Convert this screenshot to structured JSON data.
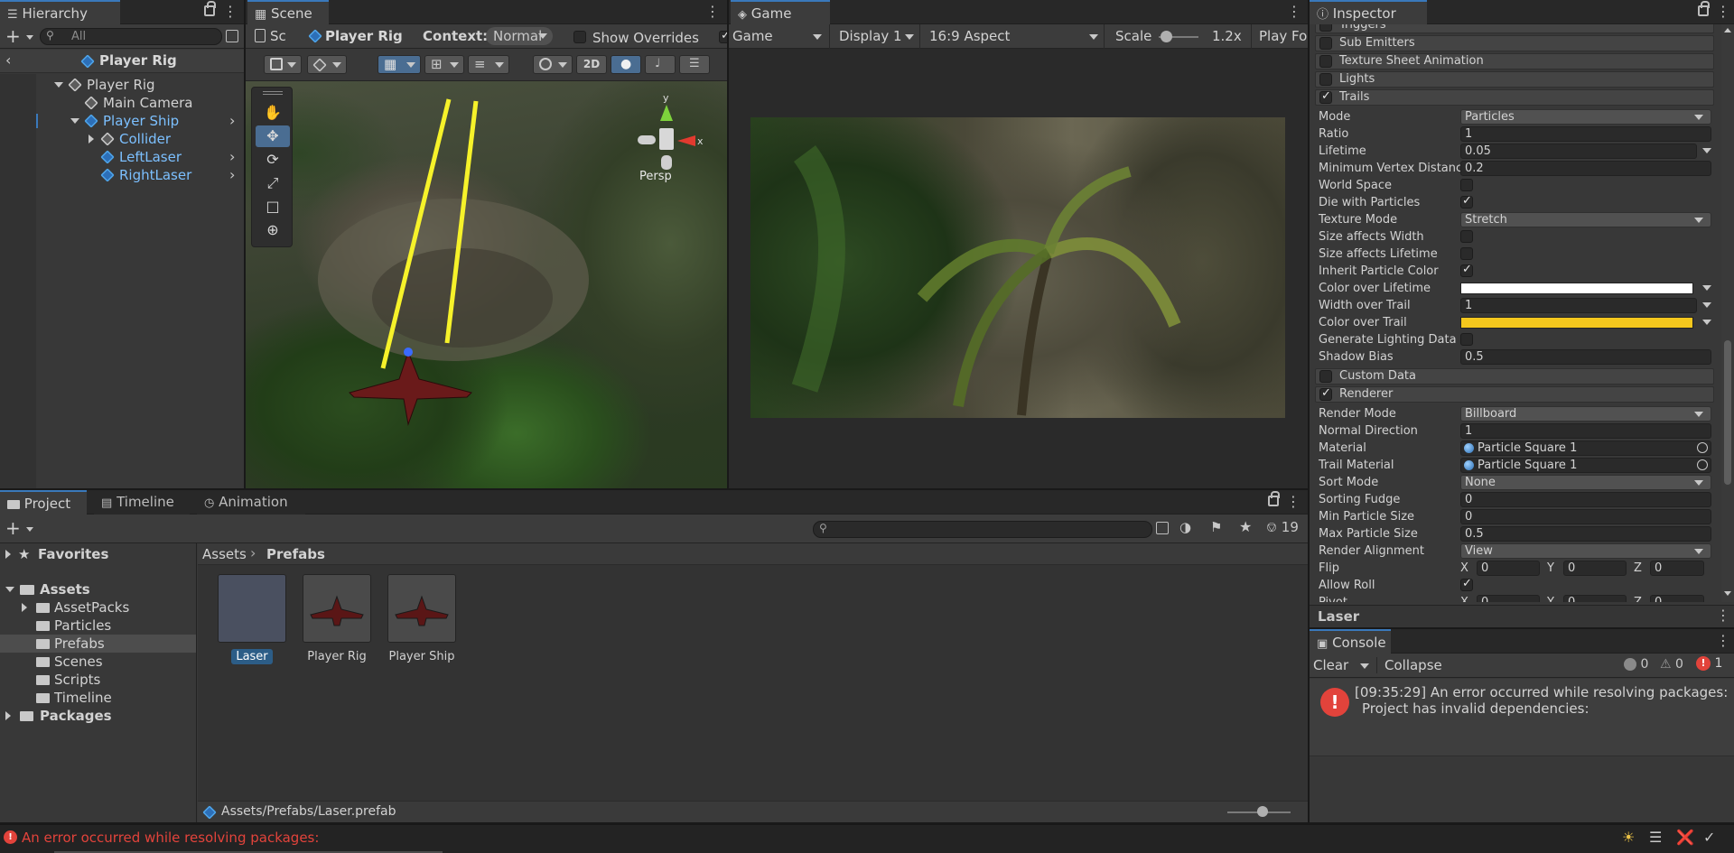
{
  "hierarchy": {
    "tab": "Hierarchy",
    "search_placeholder": "All",
    "scene_title": "Player Rig",
    "items": [
      {
        "label": "Player Rig",
        "depth": 1
      },
      {
        "label": "Main Camera",
        "depth": 2
      },
      {
        "label": "Player Ship",
        "depth": 2
      },
      {
        "label": "Collider",
        "depth": 3
      },
      {
        "label": "LeftLaser",
        "depth": 3
      },
      {
        "label": "RightLaser",
        "depth": 3
      }
    ]
  },
  "scene": {
    "tab": "Scene",
    "breadcrumb_root": "Sc",
    "breadcrumb_item": "Player Rig",
    "context_label": "Context:",
    "context_value": "Normal",
    "show_overrides": "Show Overrides",
    "mode_2d": "2D",
    "gizmo_label": "Persp",
    "gizmo_y": "y",
    "gizmo_x": "x"
  },
  "game": {
    "tab": "Game",
    "display_mode": "Game",
    "display": "Display 1",
    "aspect": "16:9 Aspect",
    "scale_label": "Scale",
    "scale_value": "1.2x",
    "play_focused": "Play Foc"
  },
  "inspector": {
    "tab": "Inspector",
    "sections_top": [
      {
        "label": "Triggers",
        "checked": false
      },
      {
        "label": "Sub Emitters",
        "checked": false
      },
      {
        "label": "Texture Sheet Animation",
        "checked": false
      },
      {
        "label": "Lights",
        "checked": false
      },
      {
        "label": "Trails",
        "checked": true
      }
    ],
    "trails": [
      {
        "label": "Mode",
        "type": "dropdown",
        "value": "Particles"
      },
      {
        "label": "Ratio",
        "type": "text",
        "value": "1"
      },
      {
        "label": "Lifetime",
        "type": "curve",
        "value": "0.05"
      },
      {
        "label": "Minimum Vertex Distance",
        "type": "text",
        "value": "0.2"
      },
      {
        "label": "World Space",
        "type": "check",
        "value": ""
      },
      {
        "label": "Die with Particles",
        "type": "checkon",
        "value": ""
      },
      {
        "label": "Texture Mode",
        "type": "dropdown",
        "value": "Stretch"
      },
      {
        "label": "Size affects Width",
        "type": "check",
        "value": ""
      },
      {
        "label": "Size affects Lifetime",
        "type": "check",
        "value": ""
      },
      {
        "label": "Inherit Particle Color",
        "type": "checkon",
        "value": ""
      },
      {
        "label": "Color over Lifetime",
        "type": "color",
        "value": "#ffffff"
      },
      {
        "label": "Width over Trail",
        "type": "curve",
        "value": "1"
      },
      {
        "label": "Color over Trail",
        "type": "color",
        "value": "#f4c71d"
      },
      {
        "label": "Generate Lighting Data",
        "type": "check",
        "value": ""
      },
      {
        "label": "Shadow Bias",
        "type": "text",
        "value": "0.5"
      }
    ],
    "sections_mid": [
      {
        "label": "Custom Data",
        "checked": false
      },
      {
        "label": "Renderer",
        "checked": true
      }
    ],
    "renderer": [
      {
        "label": "Render Mode",
        "type": "dropdown",
        "value": "Billboard"
      },
      {
        "label": "Normal Direction",
        "type": "text",
        "value": "1"
      },
      {
        "label": "Material",
        "type": "object",
        "value": "Particle Square 1"
      },
      {
        "label": "Trail Material",
        "type": "object",
        "value": "Particle Square 1"
      },
      {
        "label": "Sort Mode",
        "type": "dropdown",
        "value": "None"
      },
      {
        "label": "Sorting Fudge",
        "type": "text",
        "value": "0"
      },
      {
        "label": "Min Particle Size",
        "type": "text",
        "value": "0"
      },
      {
        "label": "Max Particle Size",
        "type": "text",
        "value": "0.5"
      },
      {
        "label": "Render Alignment",
        "type": "dropdown",
        "value": "View"
      },
      {
        "label": "Flip",
        "type": "xyz",
        "value": ""
      },
      {
        "label": "Allow Roll",
        "type": "checkon",
        "value": ""
      },
      {
        "label": "Pivot",
        "type": "xyz",
        "value": ""
      }
    ],
    "xyz": {
      "x": "X",
      "y": "Y",
      "z": "Z",
      "val": "0"
    },
    "preview_title": "Laser"
  },
  "console": {
    "tab": "Console",
    "clear": "Clear",
    "collapse": "Collapse",
    "info_count": "0",
    "warn_count": "0",
    "error_count": "1",
    "message_line1": "[09:35:29] An error occurred while resolving packages:",
    "message_line2": "Project has invalid dependencies:"
  },
  "project": {
    "tabs": [
      "Project",
      "Timeline",
      "Animation"
    ],
    "hidden_count": "19",
    "favorites": "Favorites",
    "assets": "Assets",
    "folders": [
      "AssetPacks",
      "Particles",
      "Prefabs",
      "Scenes",
      "Scripts",
      "Timeline"
    ],
    "packages": "Packages",
    "breadcrumb_root": "Assets",
    "breadcrumb_current": "Prefabs",
    "items": [
      "Laser",
      "Player Rig",
      "Player Ship"
    ],
    "selected_path": "Assets/Prefabs/Laser.prefab",
    "thumb_zoom": 0.55
  },
  "status": {
    "error": "An error occurred while resolving packages:"
  },
  "colors": {
    "accent": "#3a79bb",
    "error": "#e2433b",
    "laser": "#f6f22a"
  }
}
